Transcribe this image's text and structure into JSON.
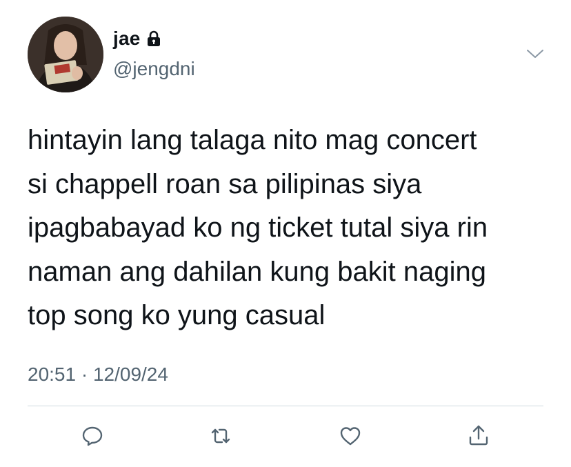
{
  "author": {
    "display_name": "jae",
    "handle": "@jengdni",
    "protected_icon": "lock-icon"
  },
  "tweet": {
    "lines": [
      "hintayin lang talaga nito mag concert",
      "si chappell roan sa pilipinas siya",
      "ipagbabayad ko ng ticket tutal siya rin",
      "naman ang dahilan kung bakit naging",
      "top song ko yung casual"
    ],
    "timestamp": "20:51 · 12/09/24"
  },
  "actions": [
    {
      "name": "reply",
      "icon": "reply-icon"
    },
    {
      "name": "retweet",
      "icon": "retweet-icon"
    },
    {
      "name": "like",
      "icon": "heart-icon"
    },
    {
      "name": "share",
      "icon": "share-icon"
    }
  ],
  "colors": {
    "text_primary": "#0f1419",
    "text_secondary": "#536471",
    "icon": "#536471",
    "divider": "#cfd9de",
    "background": "#ffffff"
  }
}
